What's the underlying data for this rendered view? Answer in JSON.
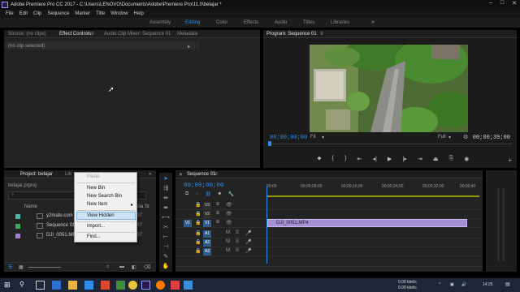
{
  "window": {
    "title": "Adobe Premiere Pro CC 2017 - C:\\Users\\LENOVO\\Documents\\Adobe\\Premiere Pro\\11.0\\belajar *"
  },
  "menu": [
    "File",
    "Edit",
    "Clip",
    "Sequence",
    "Marker",
    "Title",
    "Window",
    "Help"
  ],
  "workspaces": {
    "items": [
      "Assembly",
      "Editing",
      "Color",
      "Effects",
      "Audio",
      "Titles",
      "Libraries"
    ],
    "active": "Editing"
  },
  "source_panel": {
    "tabs": [
      "Source: (no clips)",
      "Effect Controls",
      "Audio Clip Mixer: Sequence 01",
      "Metadata"
    ],
    "active_tab": "Effect Controls",
    "message": "(no clip selected)"
  },
  "program_panel": {
    "tab": "Program: Sequence 01",
    "timecode_current": "00;00;00;00",
    "timecode_duration": "00;00;39;00",
    "zoom": "Fit",
    "resolution": "Full"
  },
  "project_panel": {
    "tabs": [
      "Project: belajar",
      "Lib"
    ],
    "file": "belajar.prproj",
    "column_name": "Name",
    "column_rate": "Media St",
    "items": [
      {
        "label": "y2mate.com - Tow",
        "rate": "29,97",
        "color": "#4fb3a7"
      },
      {
        "label": "Sequence 01",
        "rate": "29,97",
        "color": "#3fa858"
      },
      {
        "label": "DJI_0051.MP4",
        "rate": "29,97",
        "color": "#9d7fd6"
      }
    ]
  },
  "context_menu": {
    "items": [
      "Paste",
      "New Bin",
      "New Search Bin",
      "New Item",
      "View Hidden",
      "Import...",
      "Find..."
    ],
    "highlighted": "View Hidden"
  },
  "timeline": {
    "tab": "Sequence 01",
    "timecode": "00;00;00;00",
    "ruler_labels": [
      "00;00",
      "00;00;08;00",
      "00;00;16;00",
      "00;00;24;00",
      "00;00;32;00",
      "00;00;40"
    ],
    "tracks": [
      "V3",
      "V2",
      "V1",
      "A1",
      "A2",
      "A3"
    ],
    "clip_label": "DJI_0051.MP4"
  },
  "taskbar": {
    "net_up": "0.00 kbit/s",
    "net_down": "0.00 kbit/s",
    "time": "14:25"
  },
  "colors": {
    "accent": "#2d8ceb",
    "clip": "#a58ed6"
  }
}
